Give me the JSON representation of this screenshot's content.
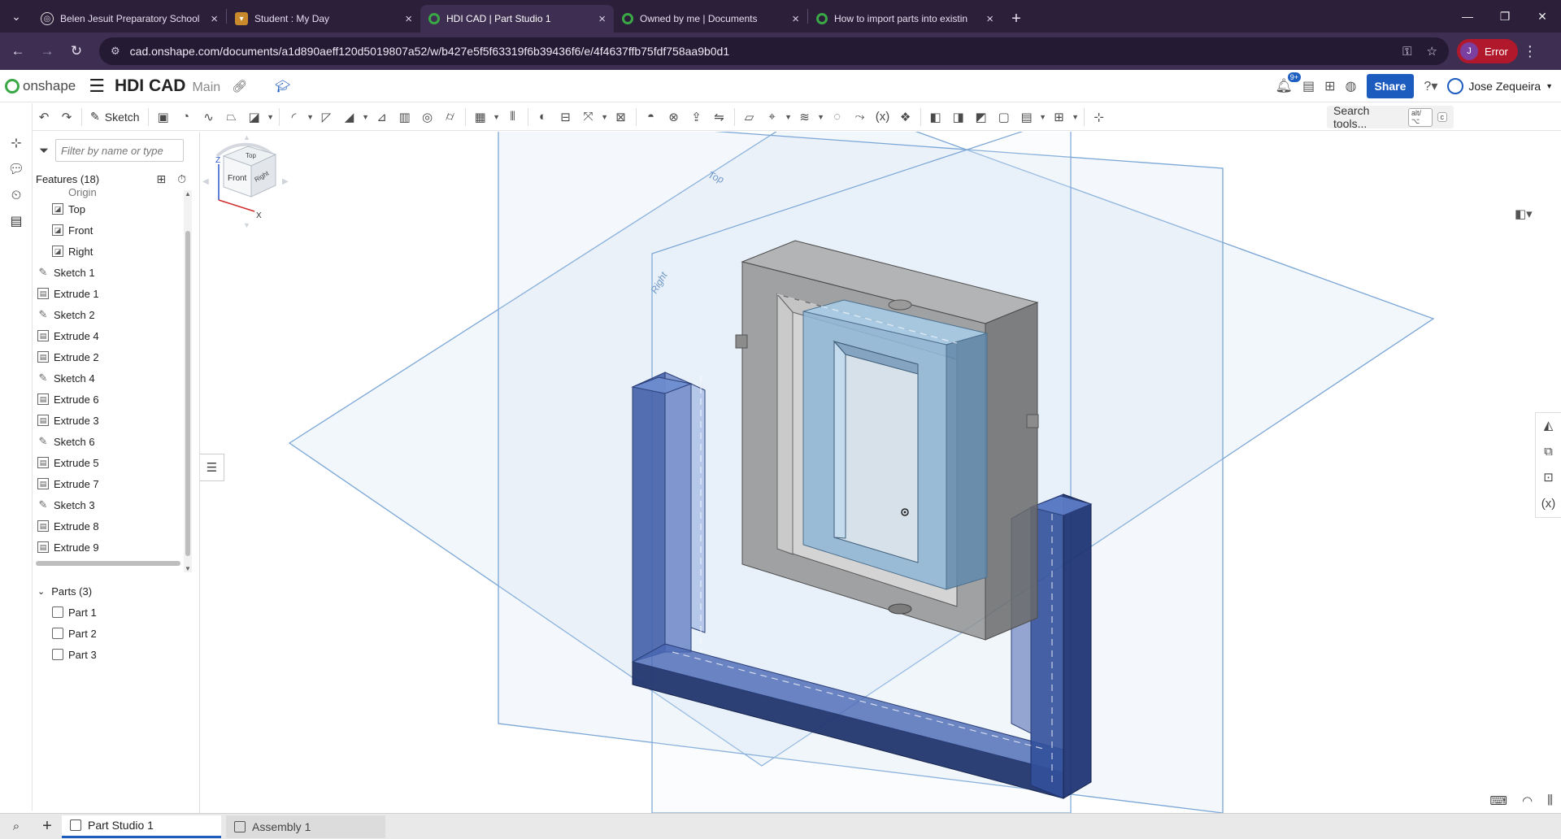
{
  "browser": {
    "tabs": [
      {
        "title": "Belen Jesuit Preparatory School",
        "active": false
      },
      {
        "title": "Student : My Day",
        "active": false
      },
      {
        "title": "HDI CAD | Part Studio 1",
        "active": true
      },
      {
        "title": "Owned by me | Documents",
        "active": false
      },
      {
        "title": "How to import parts into existin",
        "active": false
      }
    ],
    "url": "cad.onshape.com/documents/a1d890aeff120d5019807a52/w/b427e5f5f63319f6b39436f6/e/4f4637ffb75fdf758aa9b0d1",
    "profile_initial": "J",
    "profile_status": "Error"
  },
  "app": {
    "logo_text": "onshape",
    "document_name": "HDI CAD",
    "branch": "Main",
    "notifications_badge": "9+",
    "share_label": "Share",
    "user_name": "Jose Zequeira"
  },
  "toolbar": {
    "sketch_label": "Sketch",
    "search_label": "Search tools...",
    "search_shortcut_1": "alt/⌥",
    "search_shortcut_2": "c"
  },
  "feature_panel": {
    "filter_placeholder": "Filter by name or type",
    "features_header": "Features (18)",
    "partial_item": "Origin",
    "planes": [
      "Top",
      "Front",
      "Right"
    ],
    "features": [
      {
        "label": "Sketch 1",
        "kind": "sketch"
      },
      {
        "label": "Extrude 1",
        "kind": "extrude"
      },
      {
        "label": "Sketch 2",
        "kind": "sketch"
      },
      {
        "label": "Extrude 4",
        "kind": "extrude"
      },
      {
        "label": "Extrude 2",
        "kind": "extrude"
      },
      {
        "label": "Sketch 4",
        "kind": "sketch"
      },
      {
        "label": "Extrude 6",
        "kind": "extrude"
      },
      {
        "label": "Extrude 3",
        "kind": "extrude"
      },
      {
        "label": "Sketch 6",
        "kind": "sketch"
      },
      {
        "label": "Extrude 5",
        "kind": "extrude"
      },
      {
        "label": "Extrude 7",
        "kind": "extrude"
      },
      {
        "label": "Sketch 3",
        "kind": "sketch"
      },
      {
        "label": "Extrude 8",
        "kind": "extrude"
      },
      {
        "label": "Extrude 9",
        "kind": "extrude"
      }
    ],
    "parts_header": "Parts (3)",
    "parts": [
      "Part 1",
      "Part 2",
      "Part 3"
    ]
  },
  "viewport": {
    "plane_labels": {
      "top": "Top",
      "right": "Right"
    },
    "viewcube": {
      "front": "Front",
      "top": "Top",
      "right": "Right",
      "axis_z": "Z",
      "axis_x": "X"
    }
  },
  "bottom_tabs": [
    "Part Studio 1",
    "Assembly 1"
  ],
  "colors": {
    "browser_tabbar": "#2b1f3a",
    "address_bar": "#3d2e52",
    "share_button": "#1d5cbf",
    "plane_outline": "#7aa6d6",
    "blue_part": "#3d5a9e",
    "gray_part": "#8a8a8a",
    "light_blue_part": "#9cc3e0"
  }
}
